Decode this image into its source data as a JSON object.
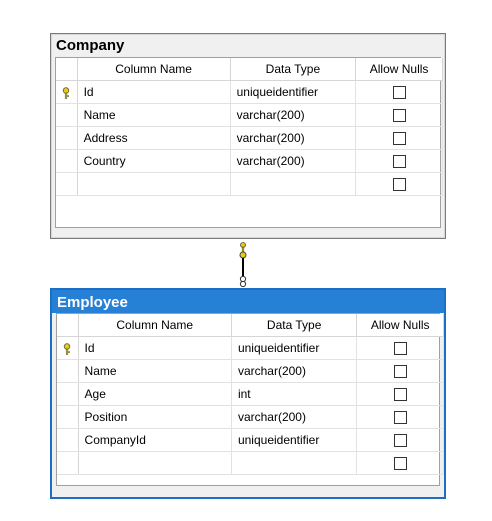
{
  "tables": [
    {
      "title": "Company",
      "headers": {
        "column_name": "Column Name",
        "data_type": "Data Type",
        "allow_nulls": "Allow Nulls"
      },
      "rows": [
        {
          "name": "Id",
          "type": "uniqueidentifier",
          "key": true
        },
        {
          "name": "Name",
          "type": "varchar(200)",
          "key": false
        },
        {
          "name": "Address",
          "type": "varchar(200)",
          "key": false
        },
        {
          "name": "Country",
          "type": "varchar(200)",
          "key": false
        },
        {
          "name": "",
          "type": "",
          "key": false
        }
      ]
    },
    {
      "title": "Employee",
      "headers": {
        "column_name": "Column Name",
        "data_type": "Data Type",
        "allow_nulls": "Allow Nulls"
      },
      "rows": [
        {
          "name": "Id",
          "type": "uniqueidentifier",
          "key": true
        },
        {
          "name": "Name",
          "type": "varchar(200)",
          "key": false
        },
        {
          "name": "Age",
          "type": "int",
          "key": false
        },
        {
          "name": "Position",
          "type": "varchar(200)",
          "key": false
        },
        {
          "name": "CompanyId",
          "type": "uniqueidentifier",
          "key": false
        },
        {
          "name": "",
          "type": "",
          "key": false
        }
      ]
    }
  ],
  "colors": {
    "selected_title": "#2680d6",
    "key_icon": "#e8d000"
  },
  "icons": {
    "primary_key": "key-icon",
    "relationship": "relationship-connector-icon"
  }
}
